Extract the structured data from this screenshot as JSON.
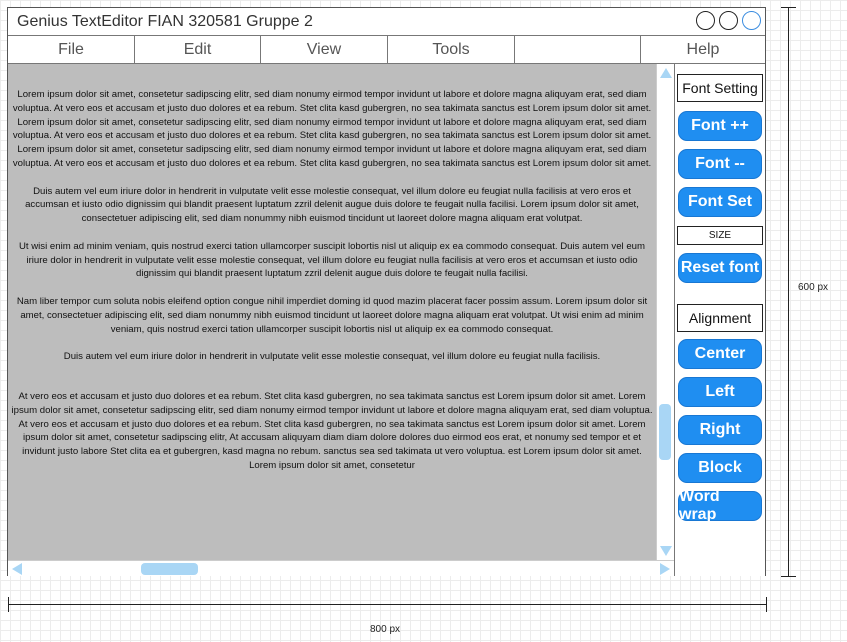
{
  "window": {
    "title": "Genius TextEditor FIAN 320581 Gruppe 2"
  },
  "menu": {
    "items": [
      "File",
      "Edit",
      "View",
      "Tools",
      "",
      "Help"
    ]
  },
  "editor": {
    "paragraphs": [
      "Lorem ipsum dolor sit amet, consetetur sadipscing elitr, sed diam nonumy eirmod tempor invidunt ut labore et dolore magna aliquyam erat, sed diam voluptua. At vero eos et accusam et justo duo dolores et ea rebum. Stet clita kasd gubergren, no sea takimata sanctus est Lorem ipsum dolor sit amet. Lorem ipsum dolor sit amet, consetetur sadipscing elitr, sed diam nonumy eirmod tempor invidunt ut labore et dolore magna aliquyam erat, sed diam voluptua. At vero eos et accusam et justo duo dolores et ea rebum. Stet clita kasd gubergren, no sea takimata sanctus est Lorem ipsum dolor sit amet. Lorem ipsum dolor sit amet, consetetur sadipscing elitr, sed diam nonumy eirmod tempor invidunt ut labore et dolore magna aliquyam erat, sed diam voluptua. At vero eos et accusam et justo duo dolores et ea rebum. Stet clita kasd gubergren, no sea takimata sanctus est Lorem ipsum dolor sit amet.",
      "Duis autem vel eum iriure dolor in hendrerit in vulputate velit esse molestie consequat, vel illum dolore eu feugiat nulla facilisis at vero eros et accumsan et iusto odio dignissim qui blandit praesent luptatum zzril delenit augue duis dolore te feugait nulla facilisi. Lorem ipsum dolor sit amet, consectetuer adipiscing elit, sed diam nonummy nibh euismod tincidunt ut laoreet dolore magna aliquam erat volutpat.",
      "Ut wisi enim ad minim veniam, quis nostrud exerci tation ullamcorper suscipit lobortis nisl ut aliquip ex ea commodo consequat. Duis autem vel eum iriure dolor in hendrerit in vulputate velit esse molestie consequat, vel illum dolore eu feugiat nulla facilisis at vero eros et accumsan et iusto odio dignissim qui blandit praesent luptatum zzril delenit augue duis dolore te feugait nulla facilisi.",
      "Nam liber tempor cum soluta nobis eleifend option congue nihil imperdiet doming id quod mazim placerat facer possim assum. Lorem ipsum dolor sit amet, consectetuer adipiscing elit, sed diam nonummy nibh euismod tincidunt ut laoreet dolore magna aliquam erat volutpat. Ut wisi enim ad minim veniam, quis nostrud exerci tation ullamcorper suscipit lobortis nisl ut aliquip ex ea commodo consequat.",
      "Duis autem vel eum iriure dolor in hendrerit in vulputate velit esse molestie consequat, vel illum dolore eu feugiat nulla facilisis.",
      "At vero eos et accusam et justo duo dolores et ea rebum. Stet clita kasd gubergren, no sea takimata sanctus est Lorem ipsum dolor sit amet. Lorem ipsum dolor sit amet, consetetur sadipscing elitr, sed diam nonumy eirmod tempor invidunt ut labore et dolore magna aliquyam erat, sed diam voluptua. At vero eos et accusam et justo duo dolores et ea rebum. Stet clita kasd gubergren, no sea takimata sanctus est Lorem ipsum dolor sit amet. Lorem ipsum dolor sit amet, consetetur sadipscing elitr, At accusam aliquyam diam diam dolore dolores duo eirmod eos erat, et nonumy sed tempor et et invidunt justo labore Stet clita ea et gubergren, kasd magna no rebum. sanctus sea sed takimata ut vero voluptua. est Lorem ipsum dolor sit amet. Lorem ipsum dolor sit amet, consetetur"
    ]
  },
  "panel": {
    "font_setting_label": "Font Setting",
    "font_increase": "Font ++",
    "font_decrease": "Font --",
    "font_set": "Font Set",
    "size_label": "SIZE",
    "reset_font": "Reset font",
    "alignment_label": "Alignment",
    "center": "Center",
    "left": "Left",
    "right": "Right",
    "block": "Block",
    "word_wrap": "Word wrap"
  },
  "dimensions": {
    "width_label": "800 px",
    "height_label": "600 px"
  },
  "colors": {
    "button": "#1f8ef1",
    "editor_background": "#bdbdbd",
    "scrollbar": "#a9d6f5"
  }
}
